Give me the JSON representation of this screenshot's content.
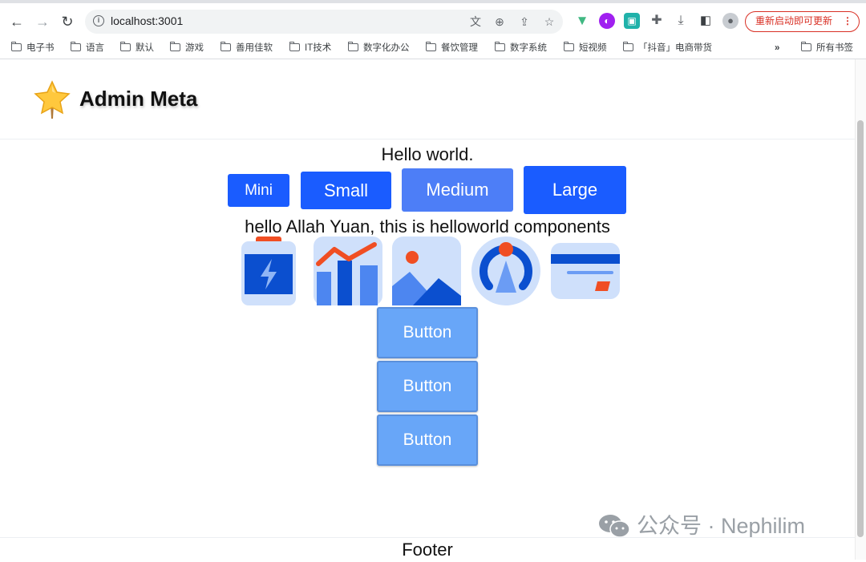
{
  "browser": {
    "url": "localhost:3001",
    "update_label": "重新启动即可更新",
    "bookmarks": [
      "电子书",
      "语言",
      "默认",
      "游戏",
      "善用佳软",
      "IT技术",
      "数字化办公",
      "餐饮管理",
      "数字系统",
      "短视频",
      "「抖音」电商带货"
    ],
    "more_label": "»",
    "all_bookmarks_label": "所有书签"
  },
  "app": {
    "title": "Admin Meta",
    "hello": "Hello world.",
    "size_buttons": [
      "Mini",
      "Small",
      "Medium",
      "Large"
    ],
    "greeting": "hello Allah Yuan, this is helloworld components",
    "icons": [
      "battery-icon",
      "bar-chart-icon",
      "image-icon",
      "location-icon",
      "credit-card-icon"
    ],
    "stack_buttons": [
      "Button",
      "Button",
      "Button"
    ],
    "footer": "Footer"
  },
  "watermark": {
    "text": "公众号 · Nephilim"
  },
  "colors": {
    "primary": "#1a5cff",
    "medium": "#4d7ef7",
    "stack_button": "#68a6f8",
    "icon_light": "#cfe0fb",
    "icon_dark": "#0b4fcf",
    "icon_accent": "#f04e23",
    "update_red": "#d93025"
  }
}
